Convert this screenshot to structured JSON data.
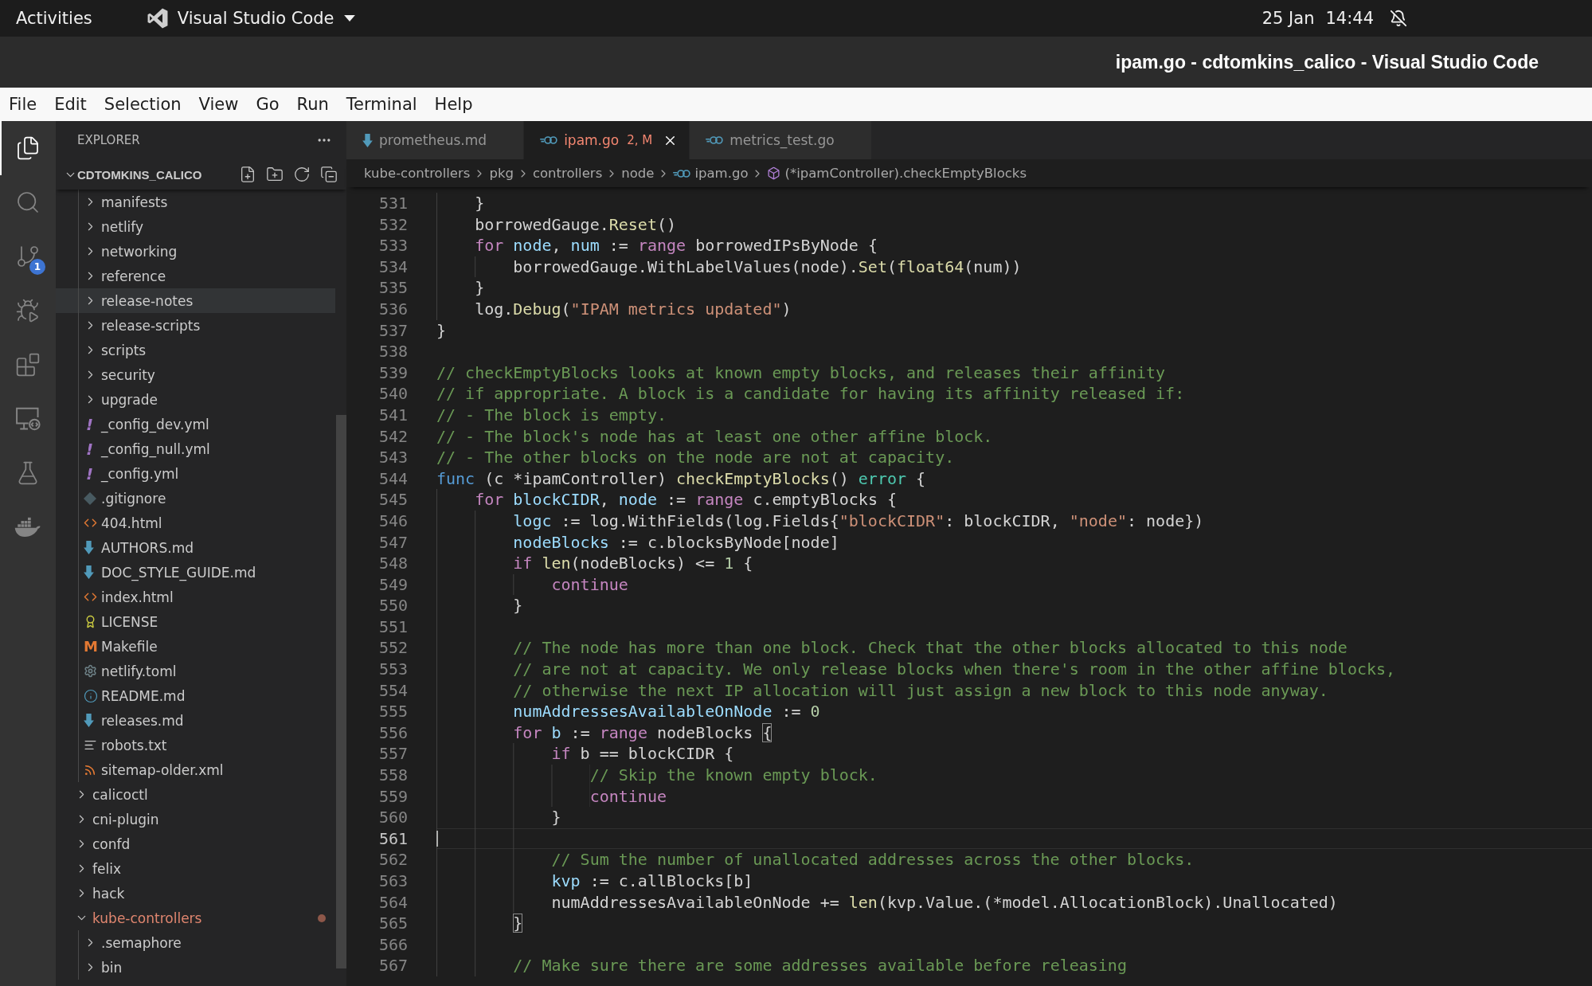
{
  "topbar": {
    "activities": "Activities",
    "app_menu": "Visual Studio Code",
    "clock": {
      "date": "25 Jan",
      "time": "14:44"
    }
  },
  "window": {
    "title": "ipam.go - cdtomkins_calico - Visual Studio Code"
  },
  "menu": [
    "File",
    "Edit",
    "Selection",
    "View",
    "Go",
    "Run",
    "Terminal",
    "Help"
  ],
  "activity_bar": [
    {
      "kind": "explorer",
      "selected": true
    },
    {
      "kind": "search",
      "selected": false
    },
    {
      "kind": "source-control",
      "selected": false,
      "badge": "1"
    },
    {
      "kind": "run-debug",
      "selected": false
    },
    {
      "kind": "extensions",
      "selected": false
    },
    {
      "kind": "remote",
      "selected": false
    },
    {
      "kind": "testing",
      "selected": false
    },
    {
      "kind": "docker",
      "selected": false
    }
  ],
  "sidebar": {
    "title": "EXPLORER",
    "root": {
      "label": "CDTOMKINS_CALICO",
      "expanded": true
    },
    "tree": [
      {
        "children": [
          {
            "label": "manifests",
            "kind": "folder",
            "expanded": false,
            "hovered": false,
            "error": false
          },
          {
            "label": "netlify",
            "kind": "folder",
            "expanded": false,
            "hovered": false,
            "error": false
          },
          {
            "label": "networking",
            "kind": "folder",
            "expanded": false,
            "hovered": false,
            "error": false
          },
          {
            "label": "reference",
            "kind": "folder",
            "expanded": false,
            "hovered": false,
            "error": false
          },
          {
            "label": "release-notes",
            "kind": "folder",
            "expanded": false,
            "hovered": true,
            "error": false
          },
          {
            "label": "release-scripts",
            "kind": "folder",
            "expanded": false,
            "hovered": false,
            "error": false
          },
          {
            "label": "scripts",
            "kind": "folder",
            "expanded": false,
            "hovered": false,
            "error": false
          },
          {
            "label": "security",
            "kind": "folder",
            "expanded": false,
            "hovered": false,
            "error": false
          },
          {
            "label": "upgrade",
            "kind": "folder",
            "expanded": false,
            "hovered": false,
            "error": false
          },
          {
            "label": "_config_dev.yml",
            "kind": "yaml",
            "glyph": "!",
            "hovered": false,
            "error": false
          },
          {
            "label": "_config_null.yml",
            "kind": "yaml",
            "glyph": "!",
            "hovered": false,
            "error": false
          },
          {
            "label": "_config.yml",
            "kind": "yaml",
            "glyph": "!",
            "hovered": false,
            "error": false
          },
          {
            "label": ".gitignore",
            "kind": "git",
            "hovered": false,
            "error": false
          },
          {
            "label": "404.html",
            "kind": "html",
            "hovered": false,
            "error": false
          },
          {
            "label": "AUTHORS.md",
            "kind": "markdown",
            "hovered": false,
            "error": false
          },
          {
            "label": "DOC_STYLE_GUIDE.md",
            "kind": "markdown",
            "hovered": false,
            "error": false
          },
          {
            "label": "index.html",
            "kind": "html",
            "hovered": false,
            "error": false
          },
          {
            "label": "LICENSE",
            "kind": "license",
            "hovered": false,
            "error": false
          },
          {
            "label": "Makefile",
            "kind": "makefile",
            "glyph": "M",
            "hovered": false,
            "error": false
          },
          {
            "label": "netlify.toml",
            "kind": "config",
            "hovered": false,
            "error": false
          },
          {
            "label": "README.md",
            "kind": "info",
            "hovered": false,
            "error": false
          },
          {
            "label": "releases.md",
            "kind": "markdown",
            "hovered": false,
            "error": false
          },
          {
            "label": "robots.txt",
            "kind": "text",
            "hovered": false,
            "error": false
          },
          {
            "label": "sitemap-older.xml",
            "kind": "feed",
            "hovered": false,
            "error": false
          }
        ]
      },
      {
        "label": "calicoctl",
        "kind": "folder",
        "expanded": false,
        "hovered": false,
        "error": false
      },
      {
        "label": "cni-plugin",
        "kind": "folder",
        "expanded": false,
        "hovered": false,
        "error": false
      },
      {
        "label": "confd",
        "kind": "folder",
        "expanded": false,
        "hovered": false,
        "error": false
      },
      {
        "label": "felix",
        "kind": "folder",
        "expanded": false,
        "hovered": false,
        "error": false
      },
      {
        "label": "hack",
        "kind": "folder",
        "expanded": false,
        "hovered": false,
        "error": false
      },
      {
        "label": "kube-controllers",
        "kind": "folder",
        "expanded": true,
        "hovered": false,
        "error": true,
        "children": [
          {
            "label": ".semaphore",
            "kind": "folder",
            "expanded": false,
            "hovered": false,
            "error": false
          },
          {
            "label": "bin",
            "kind": "folder",
            "expanded": false,
            "hovered": false,
            "error": false
          }
        ]
      }
    ]
  },
  "tabs": [
    {
      "label": "prometheus.md",
      "kind": "markdown",
      "selected": false,
      "error": false
    },
    {
      "label": "ipam.go",
      "kind": "go",
      "selected": true,
      "error": true,
      "status": "2, M"
    },
    {
      "label": "metrics_test.go",
      "kind": "go",
      "selected": false,
      "error": false
    }
  ],
  "breadcrumb": [
    {
      "label": "kube-controllers",
      "kind": "folder"
    },
    {
      "label": "pkg",
      "kind": "folder"
    },
    {
      "label": "controllers",
      "kind": "folder"
    },
    {
      "label": "node",
      "kind": "folder"
    },
    {
      "label": "ipam.go",
      "kind": "go"
    },
    {
      "label": "(*ipamController).checkEmptyBlocks",
      "kind": "method"
    }
  ],
  "editor": {
    "lines": [
      {
        "number": "531",
        "current": false,
        "tokens": [
          {
            "kind": "plain",
            "text": "    }"
          }
        ]
      },
      {
        "number": "532",
        "current": false,
        "tokens": [
          {
            "kind": "plain",
            "text": "    borrowedGauge."
          },
          {
            "kind": "func",
            "text": "Reset"
          },
          {
            "kind": "plain",
            "text": "()"
          }
        ]
      },
      {
        "number": "533",
        "current": false,
        "tokens": [
          {
            "kind": "keyword",
            "text": "    for "
          },
          {
            "kind": "var",
            "text": "node"
          },
          {
            "kind": "plain",
            "text": ", "
          },
          {
            "kind": "var",
            "text": "num"
          },
          {
            "kind": "plain",
            "text": " := "
          },
          {
            "kind": "keyword",
            "text": "range"
          },
          {
            "kind": "plain",
            "text": " borrowedIPsByNode {"
          }
        ]
      },
      {
        "number": "534",
        "current": false,
        "tokens": [
          {
            "kind": "plain",
            "text": "        borrowedGauge.WithLabelValues(node)."
          },
          {
            "kind": "func",
            "text": "Set"
          },
          {
            "kind": "plain",
            "text": "("
          },
          {
            "kind": "func",
            "text": "float64"
          },
          {
            "kind": "plain",
            "text": "(num))"
          }
        ]
      },
      {
        "number": "535",
        "current": false,
        "tokens": [
          {
            "kind": "plain",
            "text": "    }"
          }
        ]
      },
      {
        "number": "536",
        "current": false,
        "tokens": [
          {
            "kind": "plain",
            "text": "    log."
          },
          {
            "kind": "func",
            "text": "Debug"
          },
          {
            "kind": "plain",
            "text": "("
          },
          {
            "kind": "string",
            "text": "\"IPAM metrics updated\""
          },
          {
            "kind": "plain",
            "text": ")"
          }
        ]
      },
      {
        "number": "537",
        "current": false,
        "tokens": [
          {
            "kind": "plain",
            "text": "}"
          }
        ]
      },
      {
        "number": "538",
        "current": false
      },
      {
        "number": "539",
        "current": false,
        "tokens": [
          {
            "kind": "comment",
            "text": "// checkEmptyBlocks looks at known empty blocks, and releases their affinity"
          }
        ]
      },
      {
        "number": "540",
        "current": false,
        "tokens": [
          {
            "kind": "comment",
            "text": "// if appropriate. A block is a candidate for having its affinity released if:"
          }
        ]
      },
      {
        "number": "541",
        "current": false,
        "tokens": [
          {
            "kind": "comment",
            "text": "// - The block is empty."
          }
        ]
      },
      {
        "number": "542",
        "current": false,
        "tokens": [
          {
            "kind": "comment",
            "text": "// - The block's node has at least one other affine block."
          }
        ]
      },
      {
        "number": "543",
        "current": false,
        "tokens": [
          {
            "kind": "comment",
            "text": "// - The other blocks on the node are not at capacity."
          }
        ]
      },
      {
        "number": "544",
        "current": false,
        "tokens": [
          {
            "kind": "storage",
            "text": "func "
          },
          {
            "kind": "plain",
            "text": "(c *ipamController) "
          },
          {
            "kind": "func",
            "text": "checkEmptyBlocks"
          },
          {
            "kind": "plain",
            "text": "() "
          },
          {
            "kind": "type",
            "text": "error"
          },
          {
            "kind": "plain",
            "text": " {"
          }
        ]
      },
      {
        "number": "545",
        "current": false,
        "tokens": [
          {
            "kind": "keyword",
            "text": "    for "
          },
          {
            "kind": "var",
            "text": "blockCIDR"
          },
          {
            "kind": "plain",
            "text": ", "
          },
          {
            "kind": "var",
            "text": "node"
          },
          {
            "kind": "plain",
            "text": " := "
          },
          {
            "kind": "keyword",
            "text": "range"
          },
          {
            "kind": "plain",
            "text": " c.emptyBlocks {"
          }
        ]
      },
      {
        "number": "546",
        "current": false,
        "tokens": [
          {
            "kind": "var",
            "text": "        logc"
          },
          {
            "kind": "plain",
            "text": " := log.WithFields(log.Fields{"
          },
          {
            "kind": "string",
            "text": "\"blockCIDR\""
          },
          {
            "kind": "plain",
            "text": ": blockCIDR, "
          },
          {
            "kind": "string",
            "text": "\"node\""
          },
          {
            "kind": "plain",
            "text": ": node})"
          }
        ]
      },
      {
        "number": "547",
        "current": false,
        "tokens": [
          {
            "kind": "var",
            "text": "        nodeBlocks"
          },
          {
            "kind": "plain",
            "text": " := c.blocksByNode[node]"
          }
        ]
      },
      {
        "number": "548",
        "current": false,
        "tokens": [
          {
            "kind": "keyword",
            "text": "        if "
          },
          {
            "kind": "func",
            "text": "len"
          },
          {
            "kind": "plain",
            "text": "(nodeBlocks) <= "
          },
          {
            "kind": "number",
            "text": "1"
          },
          {
            "kind": "plain",
            "text": " {"
          }
        ]
      },
      {
        "number": "549",
        "current": false,
        "tokens": [
          {
            "kind": "keyword",
            "text": "            continue"
          }
        ]
      },
      {
        "number": "550",
        "current": false,
        "tokens": [
          {
            "kind": "plain",
            "text": "        }"
          }
        ]
      },
      {
        "number": "551",
        "current": false
      },
      {
        "number": "552",
        "current": false,
        "tokens": [
          {
            "kind": "comment",
            "text": "        // The node has more than one block. Check that the other blocks allocated to this node"
          }
        ]
      },
      {
        "number": "553",
        "current": false,
        "tokens": [
          {
            "kind": "comment",
            "text": "        // are not at capacity. We only release blocks when there's room in the other affine blocks,"
          }
        ]
      },
      {
        "number": "554",
        "current": false,
        "tokens": [
          {
            "kind": "comment",
            "text": "        // otherwise the next IP allocation will just assign a new block to this node anyway."
          }
        ]
      },
      {
        "number": "555",
        "current": false,
        "tokens": [
          {
            "kind": "var",
            "text": "        numAddressesAvailableOnNode"
          },
          {
            "kind": "plain",
            "text": " := "
          },
          {
            "kind": "number",
            "text": "0"
          }
        ]
      },
      {
        "number": "556",
        "current": false,
        "tokens": [
          {
            "kind": "keyword",
            "text": "        for "
          },
          {
            "kind": "var",
            "text": "b"
          },
          {
            "kind": "plain",
            "text": " := "
          },
          {
            "kind": "keyword",
            "text": "range"
          },
          {
            "kind": "plain",
            "text": " nodeBlocks "
          },
          {
            "kind": "match",
            "text": "{"
          }
        ]
      },
      {
        "number": "557",
        "current": false,
        "tokens": [
          {
            "kind": "keyword",
            "text": "            if "
          },
          {
            "kind": "plain",
            "text": "b == blockCIDR {"
          }
        ]
      },
      {
        "number": "558",
        "current": false,
        "tokens": [
          {
            "kind": "comment",
            "text": "                // Skip the known empty block."
          }
        ]
      },
      {
        "number": "559",
        "current": false,
        "tokens": [
          {
            "kind": "keyword",
            "text": "                continue"
          }
        ]
      },
      {
        "number": "560",
        "current": false,
        "tokens": [
          {
            "kind": "plain",
            "text": "            }"
          }
        ]
      },
      {
        "number": "561",
        "current": true
      },
      {
        "number": "562",
        "current": false,
        "tokens": [
          {
            "kind": "comment",
            "text": "            // Sum the number of unallocated addresses across the other blocks."
          }
        ]
      },
      {
        "number": "563",
        "current": false,
        "tokens": [
          {
            "kind": "var",
            "text": "            kvp"
          },
          {
            "kind": "plain",
            "text": " := c.allBlocks[b]"
          }
        ]
      },
      {
        "number": "564",
        "current": false,
        "tokens": [
          {
            "kind": "plain",
            "text": "            numAddressesAvailableOnNode += "
          },
          {
            "kind": "func",
            "text": "len"
          },
          {
            "kind": "plain",
            "text": "(kvp.Value.(*model.AllocationBlock).Unallocated)"
          }
        ]
      },
      {
        "number": "565",
        "current": false,
        "tokens": [
          {
            "kind": "match",
            "text": "        }"
          }
        ]
      },
      {
        "number": "566",
        "current": false
      },
      {
        "number": "567",
        "current": false,
        "tokens": [
          {
            "kind": "comment",
            "text": "        // Make sure there are some addresses available before releasing"
          }
        ]
      }
    ]
  }
}
